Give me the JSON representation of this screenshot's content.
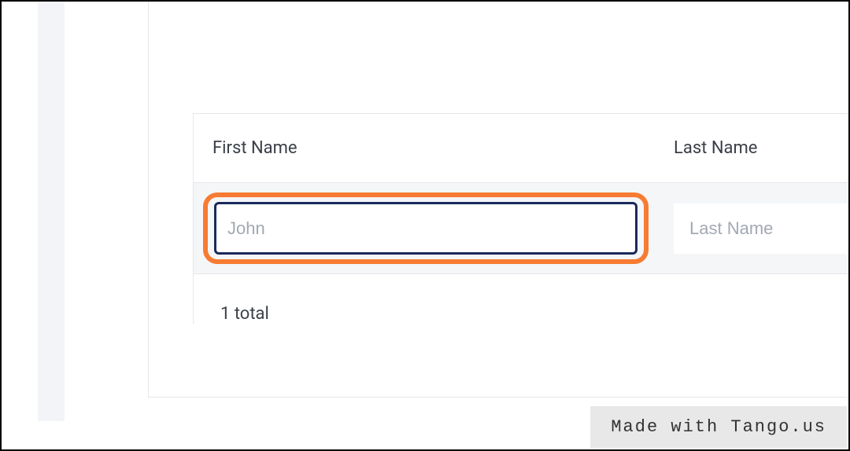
{
  "table": {
    "headers": {
      "first_name": "First Name",
      "last_name": "Last Name"
    },
    "row": {
      "first_name_value": "John",
      "last_name_placeholder": "Last Name"
    },
    "footer": "1 total"
  },
  "watermark": "Made with Tango.us"
}
